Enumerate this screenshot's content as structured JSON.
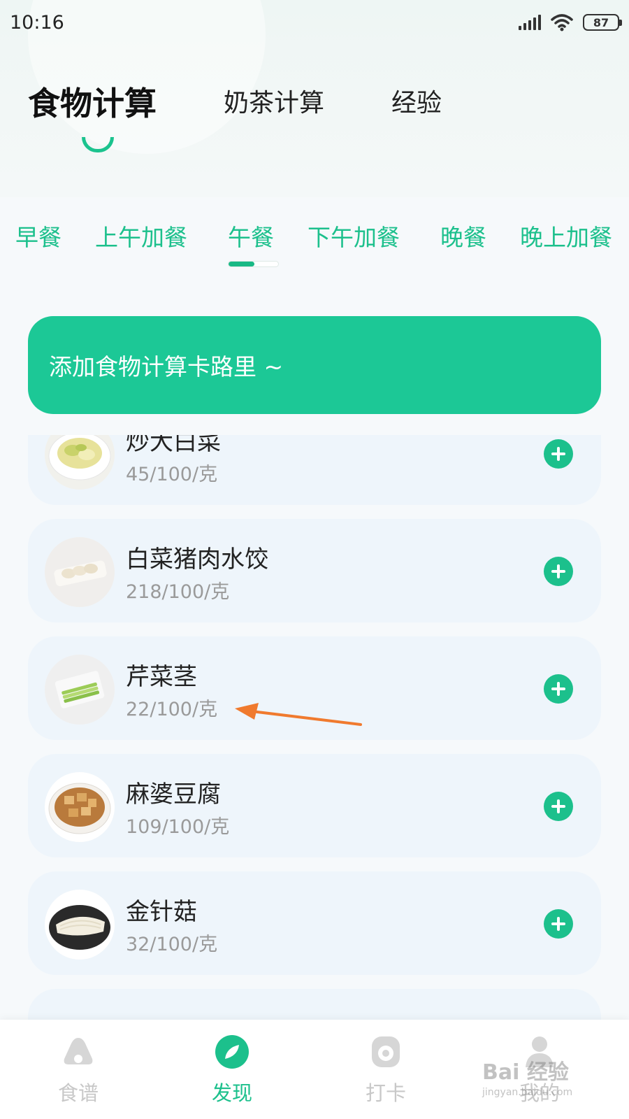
{
  "status_bar": {
    "time": "10:16",
    "battery": "87"
  },
  "top_tabs": [
    {
      "label": "食物计算",
      "active": true
    },
    {
      "label": "奶茶计算",
      "active": false
    },
    {
      "label": "经验",
      "active": false
    }
  ],
  "meal_tabs": [
    {
      "label": "早餐"
    },
    {
      "label": "上午加餐"
    },
    {
      "label": "午餐",
      "active": true
    },
    {
      "label": "下午加餐"
    },
    {
      "label": "晚餐"
    },
    {
      "label": "晚上加餐"
    }
  ],
  "add_banner": {
    "label": "添加食物计算卡路里 ~"
  },
  "foods": [
    {
      "name": "炒大白菜",
      "calories": "45/100/克"
    },
    {
      "name": "白菜猪肉水饺",
      "calories": "218/100/克"
    },
    {
      "name": "芹菜茎",
      "calories": "22/100/克"
    },
    {
      "name": "麻婆豆腐",
      "calories": "109/100/克"
    },
    {
      "name": "金针菇",
      "calories": "32/100/克"
    }
  ],
  "bottom_nav": [
    {
      "label": "食谱",
      "icon": "recipe-icon"
    },
    {
      "label": "发现",
      "icon": "discover-icon",
      "active": true
    },
    {
      "label": "打卡",
      "icon": "checkin-icon"
    },
    {
      "label": "我的",
      "icon": "profile-icon"
    }
  ],
  "watermark": {
    "brand": "Bai 经验",
    "url": "jingyan.baidu.com"
  },
  "colors": {
    "accent": "#1cc08c",
    "banner": "#1cc896",
    "annotation_arrow": "#f07a2e"
  }
}
